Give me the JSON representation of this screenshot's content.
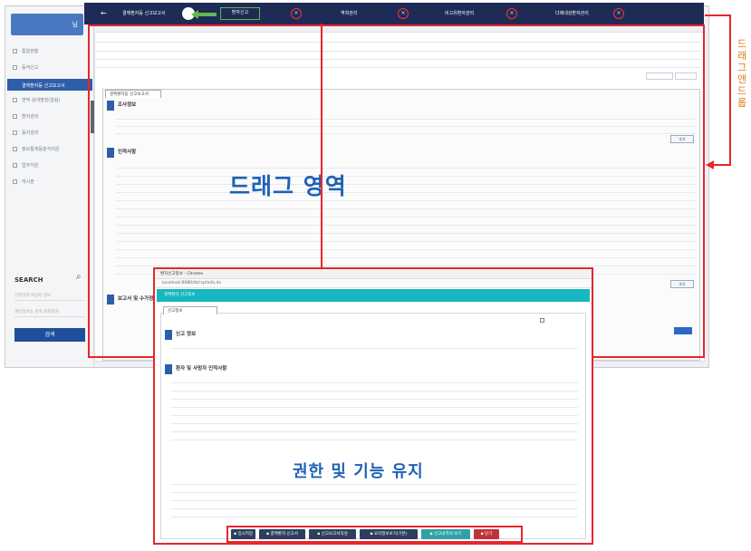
{
  "sidebar": {
    "brand_suffix": "님",
    "items": [
      {
        "label": "통합현황"
      },
      {
        "label": "동적신고"
      },
      {
        "label": "결핵환자등 신고보고서"
      },
      {
        "label": "면역 상대명칭(알림)"
      },
      {
        "label": "환자관리"
      },
      {
        "label": "동지관리"
      },
      {
        "label": "정보통계등분석지원"
      },
      {
        "label": "업무지원"
      },
      {
        "label": "게시판"
      }
    ],
    "search_title": "SEARCH",
    "search_fields": [
      "기본검색 대상자 정보",
      "개인정보등 검색 조회결과"
    ],
    "search_button": "검색"
  },
  "tabbar": {
    "tabs": [
      {
        "label": "결핵환자등 신고보고서"
      },
      {
        "label": "환자신고"
      },
      {
        "label": "역학관리"
      },
      {
        "label": "비고유환자관리"
      },
      {
        "label": "다제내성환자관리"
      }
    ],
    "close_glyph": "×",
    "back_glyph": "←"
  },
  "overlays": {
    "drag_area": "드래그 영역",
    "side_caption": "드래그앤드롭",
    "keep_power": "권한 및 기능 유지"
  },
  "back_window": {
    "panel_tab": "결핵환자등 신고보고서",
    "section_investigation": "조사정보",
    "section_patient": "인적사항",
    "section_reporter": "보고서 및 수가정보",
    "more_button": "추가"
  },
  "popup": {
    "title": "환자신고정보 - Chrome",
    "url": "localhost:8080/tb/rcptinfo.do",
    "teal_text": "결핵환자 신고정보",
    "panel_tab": "신고정보",
    "section_report": "신고 정보",
    "section_patient": "환자 및 사망자 인적사항",
    "buttons": [
      {
        "label": "임시저장",
        "style": "dark"
      },
      {
        "label": "결핵환자 신고서",
        "style": "dark"
      },
      {
        "label": "신고보고서작성",
        "style": "dark"
      },
      {
        "label": "요약정보보기(기본)",
        "style": "dark"
      },
      {
        "label": "신고내역서 보기",
        "style": "teal"
      },
      {
        "label": "닫기",
        "style": "red"
      }
    ]
  },
  "colors": {
    "highlight_red": "#e8262b",
    "accent_blue": "#1d62b8",
    "nav_dark": "#1e2b57",
    "active_green": "#59b546",
    "caption_orange": "#e07a1a"
  }
}
